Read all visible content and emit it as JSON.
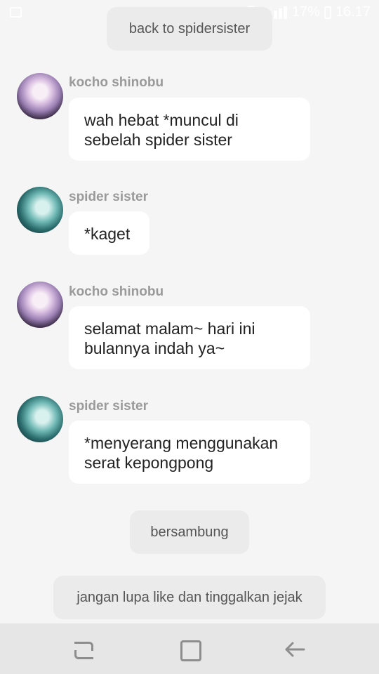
{
  "status_bar": {
    "battery": "17%",
    "time": "16.17"
  },
  "top_button": {
    "label": "back to spidersister"
  },
  "messages": [
    {
      "sender": "kocho shinobu",
      "avatar": "kocho-avatar",
      "text": "wah hebat *muncul di\nsebelah spider sister"
    },
    {
      "sender": "spider sister",
      "avatar": "spider-avatar",
      "text": "*kaget"
    },
    {
      "sender": "kocho shinobu",
      "avatar": "kocho-avatar",
      "text": "selamat malam~ hari ini\nbulannya indah ya~"
    },
    {
      "sender": "spider sister",
      "avatar": "spider-avatar",
      "text": "*menyerang menggunakan\nserat kepongpong"
    }
  ],
  "continue_button": {
    "label": "bersambung"
  },
  "footer_note": {
    "label": "jangan lupa like dan tinggalkan jejak"
  },
  "nav": {
    "recent_icon": "recent-apps-icon",
    "home_icon": "home-icon",
    "back_icon": "back-arrow-icon"
  }
}
